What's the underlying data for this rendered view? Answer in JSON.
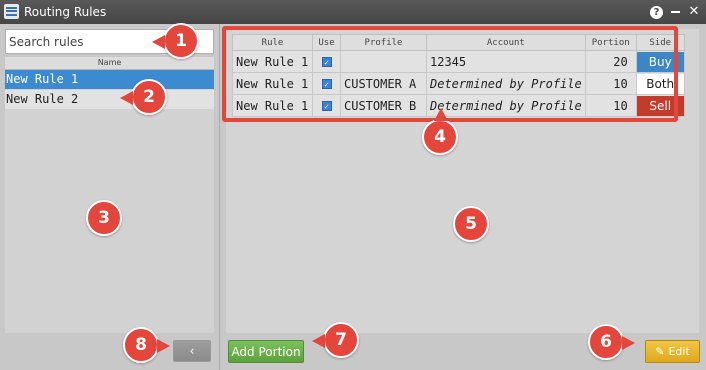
{
  "window": {
    "title": "Routing Rules",
    "help_label": "?",
    "close_label": "✕"
  },
  "search": {
    "placeholder": "Search rules"
  },
  "rules_list": {
    "header": "Name",
    "items": [
      {
        "label": "New Rule 1",
        "selected": true
      },
      {
        "label": "New Rule 2",
        "selected": false
      }
    ]
  },
  "collapse_button": {
    "label": "‹"
  },
  "table": {
    "columns": [
      "Rule",
      "Use",
      "Profile",
      "Account",
      "Portion",
      "Side"
    ],
    "rows": [
      {
        "rule": "New Rule 1",
        "use": true,
        "profile": "",
        "account": "12345",
        "account_italic": false,
        "portion": "20",
        "side": "Buy"
      },
      {
        "rule": "New Rule 1",
        "use": true,
        "profile": "CUSTOMER A",
        "account": "Determined by Profile",
        "account_italic": true,
        "portion": "10",
        "side": "Both"
      },
      {
        "rule": "New Rule 1",
        "use": true,
        "profile": "CUSTOMER B",
        "account": "Determined by Profile",
        "account_italic": true,
        "portion": "10",
        "side": "Sell"
      }
    ]
  },
  "buttons": {
    "add_portion": "Add Portion",
    "edit": "Edit"
  },
  "callouts": [
    "1",
    "2",
    "3",
    "4",
    "5",
    "6",
    "7",
    "8"
  ],
  "colors": {
    "selected": "#3c8ad0",
    "buy": "#3d86c6",
    "sell": "#c23b2b",
    "add": "#6cb24b",
    "edit": "#eab530",
    "callout": "#e4463c"
  }
}
